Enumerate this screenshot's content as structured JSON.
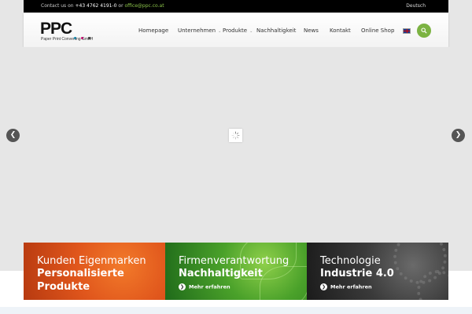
{
  "topbar": {
    "contact_prefix": "Contact us on",
    "phone": "+43 4762 4191-0",
    "or_text": "or",
    "email": "office@ppc.co.at",
    "language": "Deutsch"
  },
  "logo": {
    "mark": "PPC",
    "tagline": "Paper Print Converting GmbH",
    "dot_colors": [
      "#00a9e0",
      "#e6007e",
      "#ffd500"
    ]
  },
  "nav": {
    "items": [
      {
        "label": "Homepage"
      },
      {
        "label": "Unternehmen",
        "has_dropdown": true
      },
      {
        "label": "Produkte",
        "has_dropdown": true
      },
      {
        "label": "Nachhaltigkeit"
      },
      {
        "label": "News"
      },
      {
        "label": "Kontakt"
      },
      {
        "label": "Online Shop"
      }
    ],
    "language_flag": "uk-flag-icon",
    "search_icon": "search-icon"
  },
  "slider": {
    "prev_icon": "chevron-left-icon",
    "next_icon": "chevron-right-icon",
    "loader_icon": "spinner-icon"
  },
  "features": [
    {
      "line1": "Kunden Eigenmarken",
      "line2": "Personalisierte",
      "line3": "Produkte"
    },
    {
      "line1": "Firmenverantwortung",
      "line2": "Nachhaltigkeit",
      "more": "Mehr erfahren"
    },
    {
      "line1": "Technologie",
      "line2": "Industrie 4.0",
      "more": "Mehr erfahren"
    }
  ],
  "colors": {
    "accent": "#7cb342",
    "topbar_bg": "#000000",
    "slider_bg": "#e6e6e6"
  }
}
